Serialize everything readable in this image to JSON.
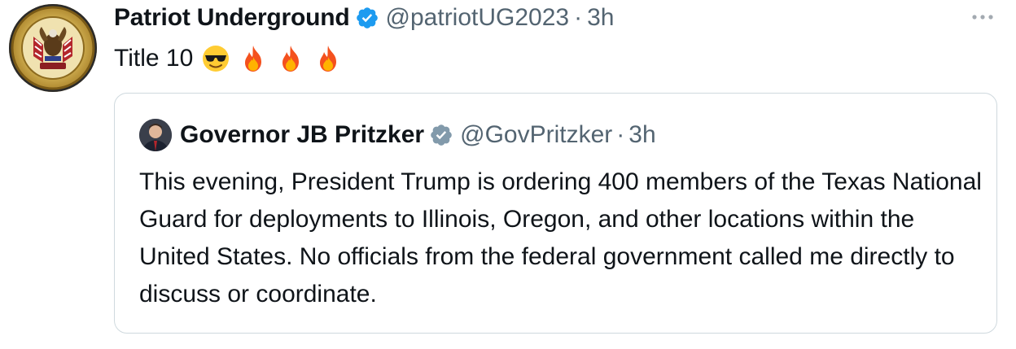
{
  "tweet": {
    "display_name": "Patriot Underground",
    "handle": "@patriotUG2023",
    "separator": "·",
    "time": "3h",
    "text": "Title 10",
    "emojis": [
      "smiling-face-with-sunglasses",
      "fire",
      "fire",
      "fire"
    ],
    "avatar_icon": "patriot-underground-seal",
    "verified_color": "#1d9bf0"
  },
  "quote": {
    "display_name": "Governor JB Pritzker",
    "handle": "@GovPritzker",
    "separator": "·",
    "time": "3h",
    "verified_color": "#829aab",
    "body": "This evening, President Trump is ordering 400 members of the Texas National Guard for deployments to Illinois, Oregon, and other locations within the United States. No officials from the federal government called me directly to discuss or coordinate."
  },
  "colors": {
    "text": "#0f1419",
    "secondary": "#536471",
    "border": "#cfd9de"
  }
}
